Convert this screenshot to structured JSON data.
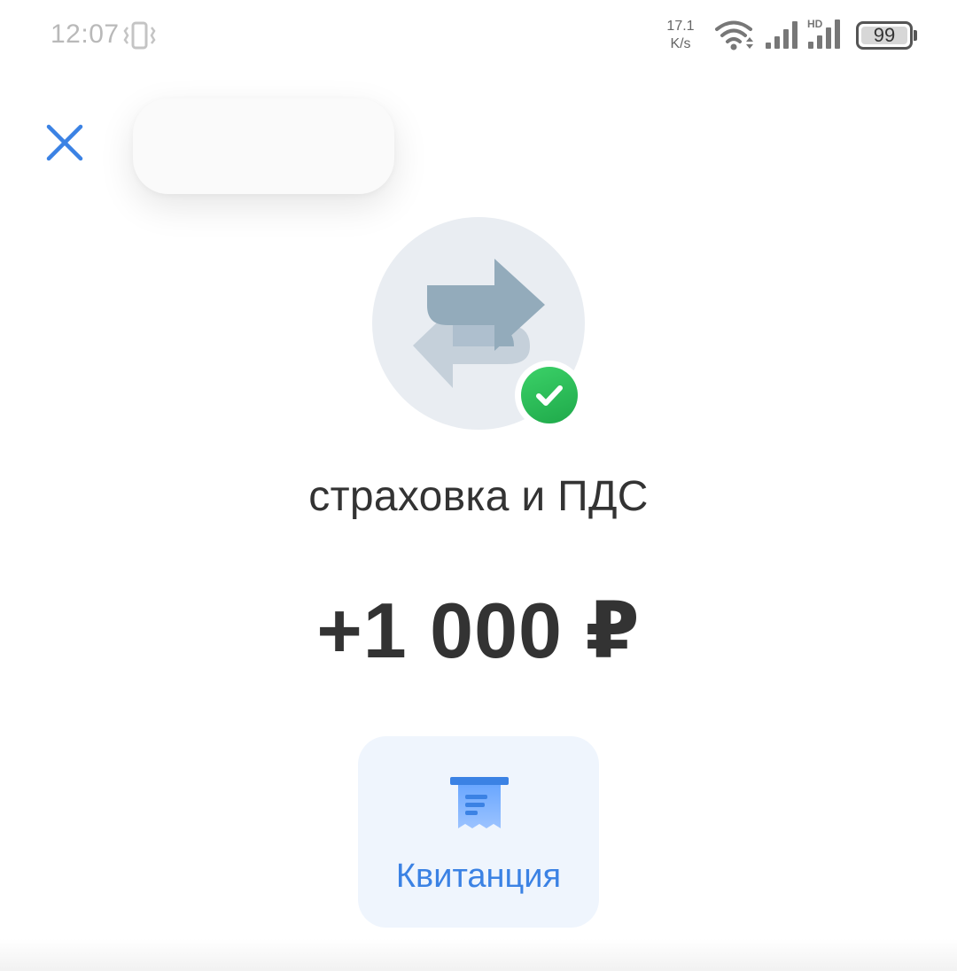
{
  "status_bar": {
    "time": "12:07",
    "net_speed_value": "17.1",
    "net_speed_unit": "K/s",
    "network_type": "HD",
    "battery_level": "99",
    "icons": [
      "vibrate-icon",
      "wifi-icon",
      "signal-icon",
      "signal-icon",
      "battery-icon"
    ]
  },
  "header": {
    "close_icon": "close-icon",
    "title": ""
  },
  "transaction": {
    "icon": "transfer-arrows-icon",
    "status_icon": "check-icon",
    "title": "страховка и ПДС",
    "amount": "+1 000 ₽"
  },
  "actions": {
    "receipt_label": "Квитанция",
    "receipt_icon": "receipt-icon"
  },
  "colors": {
    "accent": "#3b82e4",
    "success": "#27b552",
    "text": "#333333",
    "avatar_bg": "#e9edf2",
    "button_bg": "#eff5fd"
  }
}
